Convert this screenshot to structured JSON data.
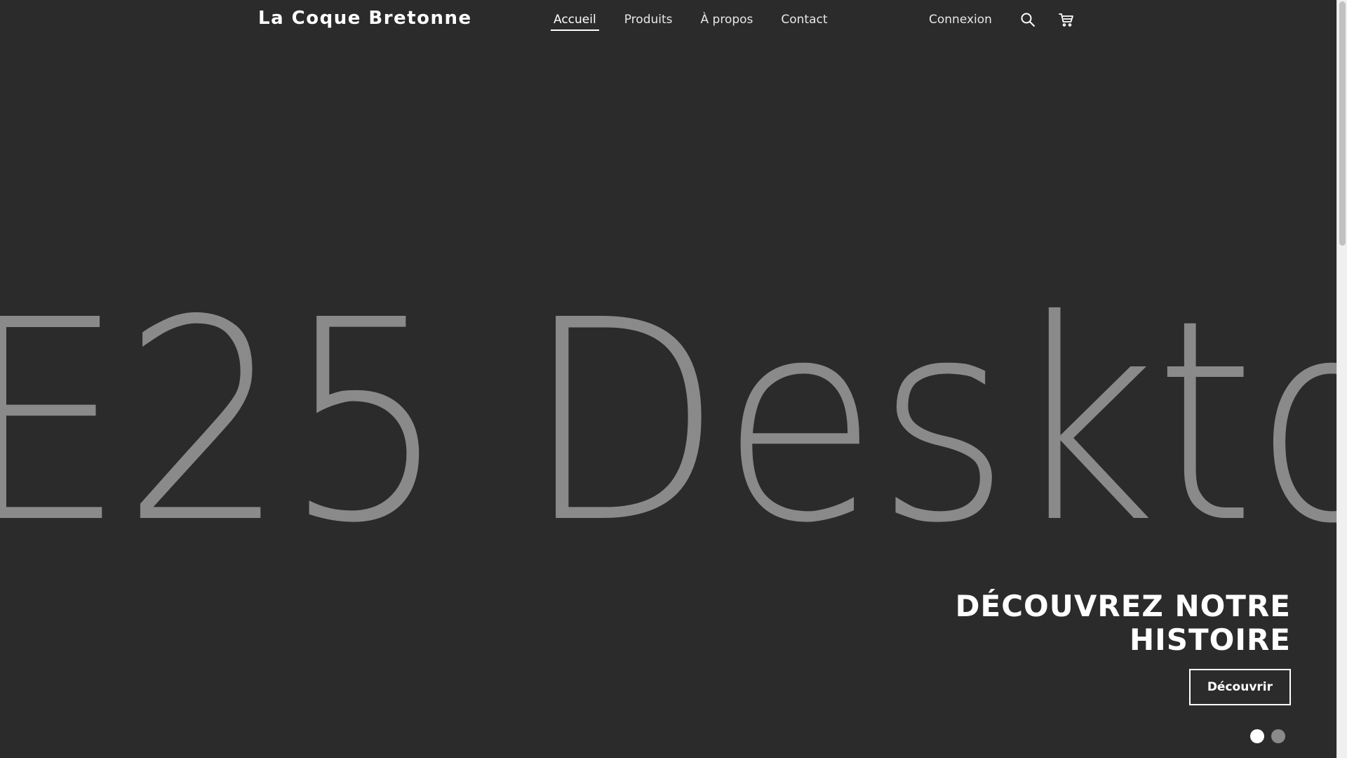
{
  "header": {
    "brand": "La Coque Bretonne",
    "nav": [
      {
        "label": "Accueil",
        "active": true
      },
      {
        "label": "Produits",
        "active": false
      },
      {
        "label": "À propos",
        "active": false
      },
      {
        "label": "Contact",
        "active": false
      }
    ],
    "login_label": "Connexion",
    "icons": [
      "search-icon",
      "cart-icon"
    ]
  },
  "hero": {
    "background_text": "E25 Deskto",
    "title_line1": "DÉCOUVREZ NOTRE",
    "title_line2": "HISTOIRE",
    "button_label": "Découvrir",
    "slides_total": 2,
    "active_slide": 1
  },
  "colors": {
    "background": "#2b2b2b",
    "text": "#ffffff",
    "muted_text": "#8a8a8a"
  }
}
